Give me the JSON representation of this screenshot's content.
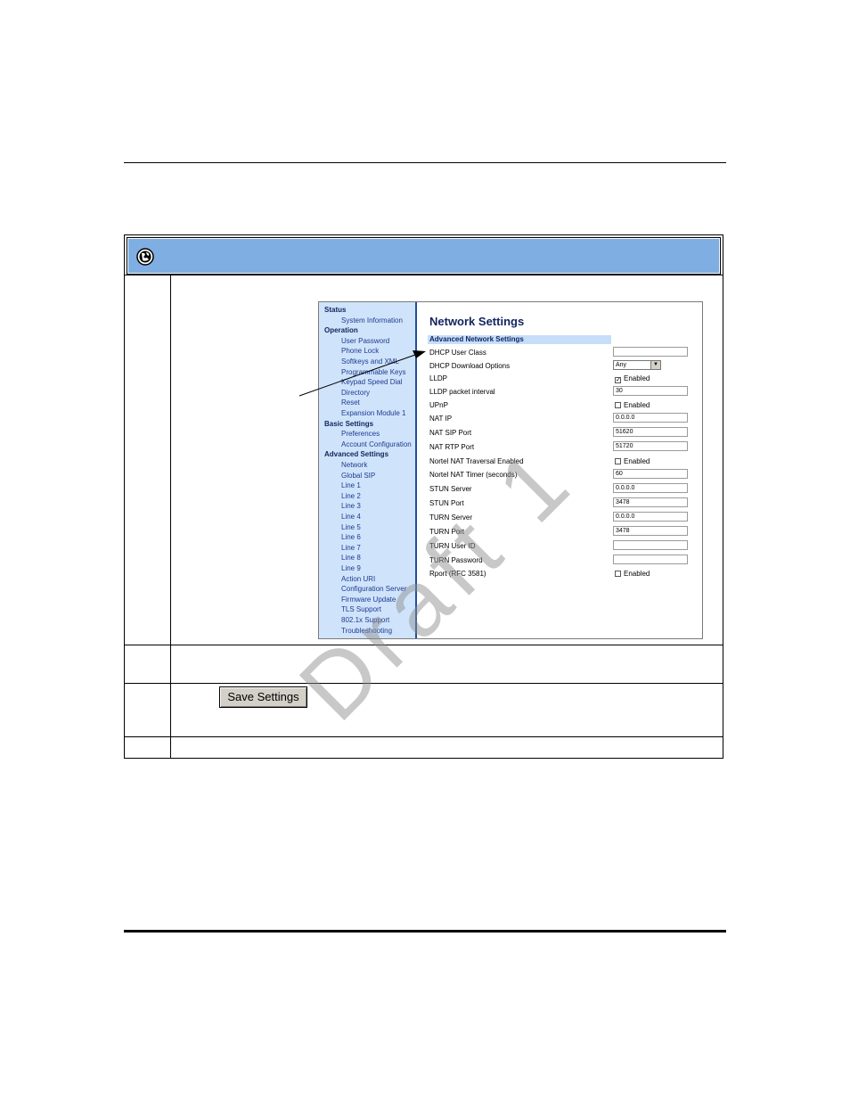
{
  "document": {
    "save_button_label": "Save Settings",
    "watermark": "Draft 1"
  },
  "screenshot": {
    "nav": [
      {
        "label": "Status",
        "level": "head"
      },
      {
        "label": "System Information",
        "level": "sub"
      },
      {
        "label": "Operation",
        "level": "head"
      },
      {
        "label": "User Password",
        "level": "sub"
      },
      {
        "label": "Phone Lock",
        "level": "sub"
      },
      {
        "label": "Softkeys and XML",
        "level": "sub"
      },
      {
        "label": "Programmable Keys",
        "level": "sub"
      },
      {
        "label": "Keypad Speed Dial",
        "level": "sub"
      },
      {
        "label": "Directory",
        "level": "sub"
      },
      {
        "label": "Reset",
        "level": "sub"
      },
      {
        "label": "Expansion Module 1",
        "level": "sub"
      },
      {
        "label": "Basic Settings",
        "level": "head"
      },
      {
        "label": "Preferences",
        "level": "sub"
      },
      {
        "label": "Account Configuration",
        "level": "sub"
      },
      {
        "label": "Advanced Settings",
        "level": "head"
      },
      {
        "label": "Network",
        "level": "sub"
      },
      {
        "label": "Global SIP",
        "level": "sub"
      },
      {
        "label": "Line 1",
        "level": "sub"
      },
      {
        "label": "Line 2",
        "level": "sub"
      },
      {
        "label": "Line 3",
        "level": "sub"
      },
      {
        "label": "Line 4",
        "level": "sub"
      },
      {
        "label": "Line 5",
        "level": "sub"
      },
      {
        "label": "Line 6",
        "level": "sub"
      },
      {
        "label": "Line 7",
        "level": "sub"
      },
      {
        "label": "Line 8",
        "level": "sub"
      },
      {
        "label": "Line 9",
        "level": "sub"
      },
      {
        "label": "Action URI",
        "level": "sub"
      },
      {
        "label": "Configuration Server",
        "level": "sub"
      },
      {
        "label": "Firmware Update",
        "level": "sub"
      },
      {
        "label": "TLS Support",
        "level": "sub"
      },
      {
        "label": "802.1x Support",
        "level": "sub"
      },
      {
        "label": "Troubleshooting",
        "level": "sub"
      }
    ],
    "title": "Network Settings",
    "section": "Advanced Network Settings",
    "rows": [
      {
        "label": "DHCP User Class",
        "type": "text",
        "value": ""
      },
      {
        "label": "DHCP Download Options",
        "type": "select",
        "value": "Any"
      },
      {
        "label": "LLDP",
        "type": "check",
        "checked": true,
        "value": "Enabled"
      },
      {
        "label": "LLDP packet interval",
        "type": "text",
        "value": "30"
      },
      {
        "label": "UPnP",
        "type": "check",
        "checked": false,
        "value": "Enabled"
      },
      {
        "label": "NAT IP",
        "type": "text",
        "value": "0.0.0.0"
      },
      {
        "label": "NAT SIP Port",
        "type": "text",
        "value": "51620"
      },
      {
        "label": "NAT RTP Port",
        "type": "text",
        "value": "51720"
      },
      {
        "label": "Nortel NAT Traversal Enabled",
        "type": "check",
        "checked": false,
        "value": "Enabled"
      },
      {
        "label": "Nortel NAT Timer (seconds)",
        "type": "text",
        "value": "60"
      },
      {
        "label": "STUN Server",
        "type": "text",
        "value": "0.0.0.0"
      },
      {
        "label": "STUN Port",
        "type": "text",
        "value": "3478"
      },
      {
        "label": "TURN Server",
        "type": "text",
        "value": "0.0.0.0"
      },
      {
        "label": "TURN Port",
        "type": "text",
        "value": "3478"
      },
      {
        "label": "TURN User ID",
        "type": "text",
        "value": ""
      },
      {
        "label": "TURN Password",
        "type": "text",
        "value": ""
      },
      {
        "label": "Rport (RFC 3581)",
        "type": "check",
        "checked": false,
        "value": "Enabled"
      }
    ]
  }
}
